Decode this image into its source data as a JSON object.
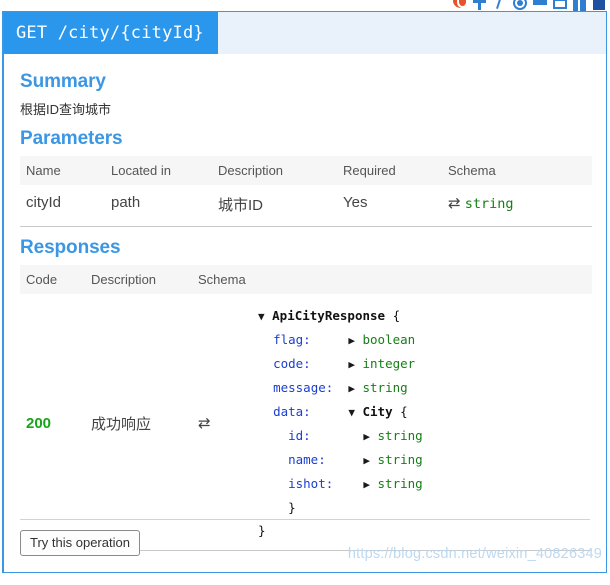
{
  "browser_toolbar": {
    "icons": [
      "opera-logo-icon",
      "plus-icon",
      "slash-icon",
      "circle-target-icon",
      "funnel-icon",
      "folder-icon",
      "book-icon",
      "square-icon"
    ]
  },
  "operation": {
    "method_and_path": "GET /city/{cityId}",
    "header_bg": "#e9f1fb",
    "tab_bg": "#2a96ec"
  },
  "summary": {
    "title": "Summary",
    "text": "根据ID查询城市"
  },
  "parameters": {
    "title": "Parameters",
    "columns": [
      "Name",
      "Located in",
      "Description",
      "Required",
      "Schema"
    ],
    "rows": [
      {
        "name": "cityId",
        "located_in": "path",
        "description": "城市ID",
        "required": "Yes",
        "schema_icon": "⇄",
        "schema_type": "string"
      }
    ]
  },
  "responses": {
    "title": "Responses",
    "columns": [
      "Code",
      "Description",
      "Schema"
    ],
    "rows": [
      {
        "code": "200",
        "description": "成功响应",
        "schema_icon": "⇄"
      }
    ],
    "schema_tree": [
      {
        "indent": 0,
        "toggle": "▼",
        "key": "",
        "model": "ApiCityResponse",
        "type": "",
        "brace": "{"
      },
      {
        "indent": 1,
        "toggle": "▶",
        "key": "flag:",
        "model": "",
        "type": "boolean",
        "brace": ""
      },
      {
        "indent": 1,
        "toggle": "▶",
        "key": "code:",
        "model": "",
        "type": "integer",
        "brace": ""
      },
      {
        "indent": 1,
        "toggle": "▶",
        "key": "message:",
        "model": "",
        "type": "string",
        "brace": ""
      },
      {
        "indent": 1,
        "toggle": "▼",
        "key": "data:",
        "model": "City",
        "type": "",
        "brace": "{"
      },
      {
        "indent": 2,
        "toggle": "▶",
        "key": "id:",
        "model": "",
        "type": "string",
        "brace": ""
      },
      {
        "indent": 2,
        "toggle": "▶",
        "key": "name:",
        "model": "",
        "type": "string",
        "brace": ""
      },
      {
        "indent": 2,
        "toggle": "▶",
        "key": "ishot:",
        "model": "",
        "type": "string",
        "brace": ""
      },
      {
        "indent": 2,
        "toggle": "",
        "key": "",
        "model": "",
        "type": "",
        "brace": "}"
      },
      {
        "indent": 0,
        "toggle": "",
        "key": "",
        "model": "",
        "type": "",
        "brace": "}"
      }
    ]
  },
  "footer": {
    "try_button_label": "Try this operation"
  },
  "watermark": {
    "text": "https://blog.csdn.net/weixin_40826349",
    "color": "#bcd9f2"
  }
}
